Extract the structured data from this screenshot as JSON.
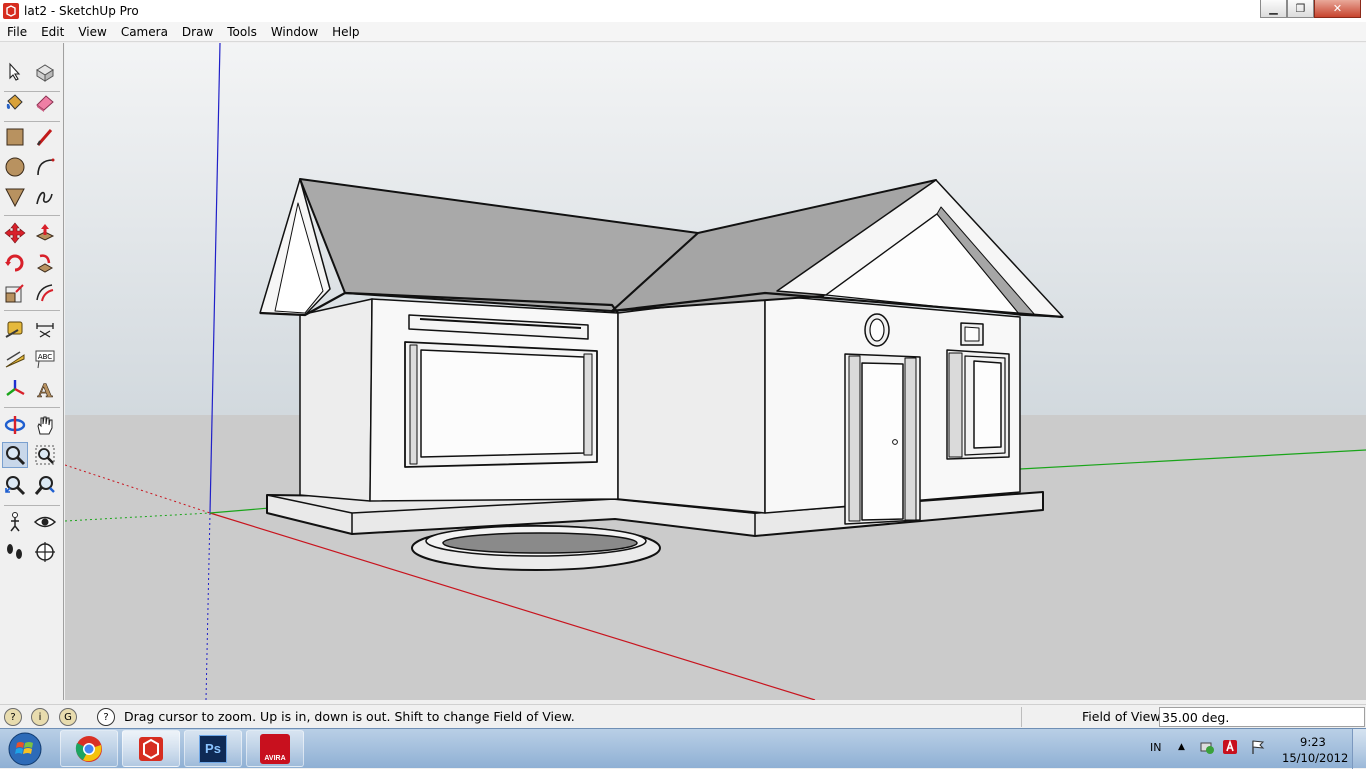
{
  "window": {
    "title": "lat2 - SketchUp Pro",
    "icon": "sketchup-icon",
    "minimize": "minimize-icon",
    "restore": "restore-icon",
    "close": "close-icon"
  },
  "menubar": {
    "items": [
      {
        "label": "File"
      },
      {
        "label": "Edit"
      },
      {
        "label": "View"
      },
      {
        "label": "Camera"
      },
      {
        "label": "Draw"
      },
      {
        "label": "Tools"
      },
      {
        "label": "Window"
      },
      {
        "label": "Help"
      }
    ]
  },
  "toolbar": {
    "tools": [
      "select-icon",
      "make-component-icon",
      "paint-bucket-icon",
      "eraser-icon",
      "rectangle-icon",
      "line-icon",
      "circle-icon",
      "arc-icon",
      "polygon-icon",
      "freehand-icon",
      "move-icon",
      "push-pull-icon",
      "rotate-icon",
      "follow-me-icon",
      "scale-icon",
      "offset-icon",
      "tape-measure-icon",
      "dimension-icon",
      "protractor-icon",
      "text-icon",
      "axes-icon",
      "3d-text-icon",
      "orbit-icon",
      "pan-icon",
      "zoom-icon",
      "zoom-window-icon",
      "zoom-extents-icon",
      "previous-view-icon",
      "position-camera-icon",
      "look-around-icon",
      "walk-icon",
      "section-plane-icon"
    ],
    "active_tool": "zoom-icon",
    "dimension_label": "ABC",
    "text_label": "A"
  },
  "status": {
    "icons": [
      "geo-location-icon",
      "credits-icon",
      "sign-in-icon",
      "help-icon"
    ],
    "message": "Drag cursor to zoom.  Up is in, down is out. Shift to change Field of View.",
    "value_label": "Field of View",
    "value": "35.00 deg."
  },
  "taskbar": {
    "start": "windows-start-icon",
    "apps": [
      {
        "name": "chrome-icon"
      },
      {
        "name": "sketchup-icon",
        "active": true
      },
      {
        "name": "photoshop-icon",
        "label": "Ps"
      },
      {
        "name": "avira-icon",
        "label": "AVIRA"
      }
    ],
    "language": "IN",
    "time": "9:23",
    "date": "15/10/2012"
  },
  "colors": {
    "sky": "#d7dde1",
    "ground": "#cbcbcb",
    "axis_red": "#c8141e",
    "axis_green": "#1aa51a",
    "axis_blue": "#2020c8",
    "roof": "#a9a9a9",
    "wall": "#f8f8f8"
  }
}
